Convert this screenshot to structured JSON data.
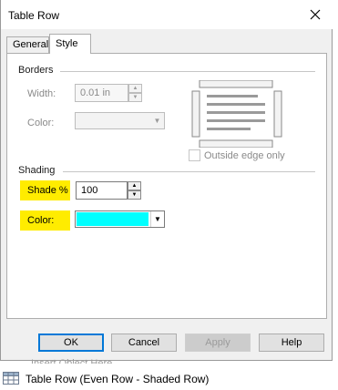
{
  "window": {
    "title": "Table Row"
  },
  "tabs": [
    {
      "label": "General",
      "active": false
    },
    {
      "label": "Style",
      "active": true
    }
  ],
  "borders": {
    "group_label": "Borders",
    "width_label": "Width:",
    "width_value": "0.01 in",
    "color_label": "Color:",
    "outside_edge_label": "Outside edge only",
    "outside_edge_checked": false
  },
  "shading": {
    "group_label": "Shading",
    "shade_label": "Shade %",
    "shade_value": "100",
    "color_label": "Color:",
    "color_value": "#00ffff"
  },
  "buttons": {
    "ok": "OK",
    "cancel": "Cancel",
    "apply": "Apply",
    "help": "Help"
  },
  "background": {
    "partial_text": "Insert Object Here",
    "tree_item_label": "Table Row (Even Row - Shaded Row)"
  },
  "colors": {
    "highlight": "#ffec00",
    "shade_color": "#00ffff",
    "accent": "#0078d7"
  }
}
